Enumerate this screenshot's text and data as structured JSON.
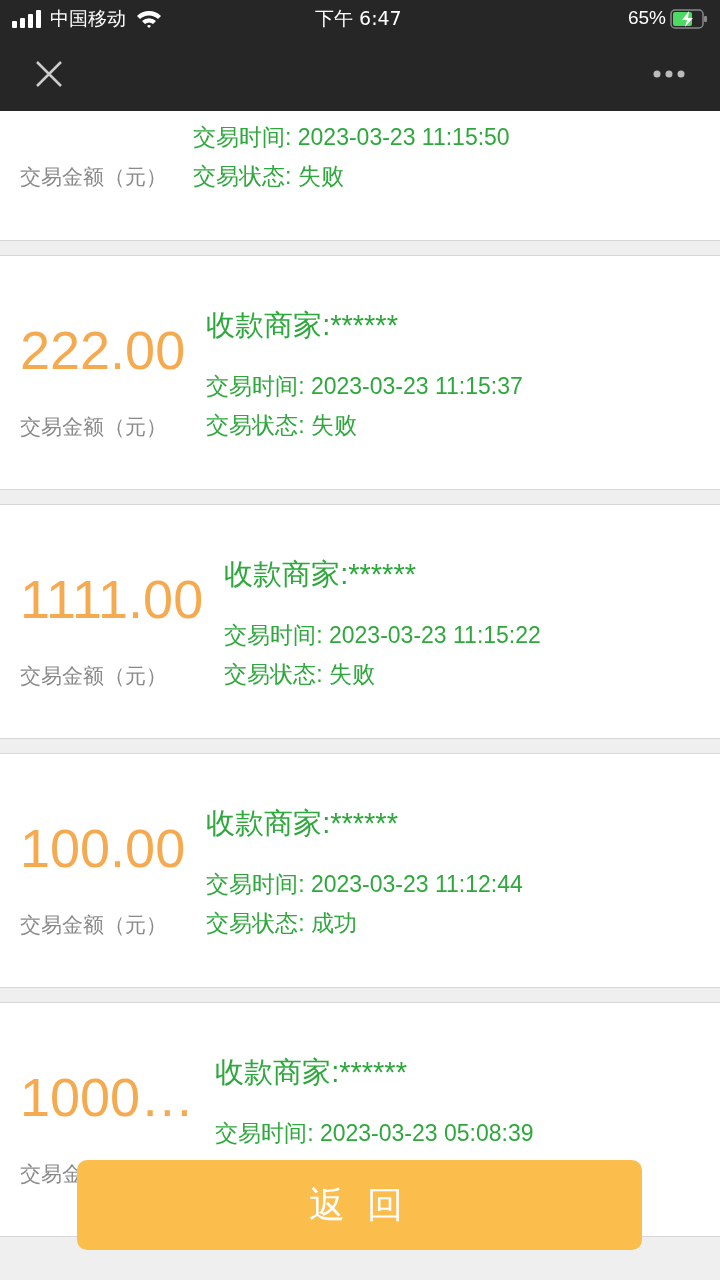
{
  "status_bar": {
    "carrier": "中国移动",
    "time": "下午 6:47",
    "battery": "65%"
  },
  "records": [
    {
      "time": "交易时间: 2023-03-23 11:15:50",
      "status": "交易状态: 失败",
      "amount_label": "交易金额（元）"
    },
    {
      "amount": "222.00",
      "merchant": "收款商家:******",
      "time": "交易时间: 2023-03-23 11:15:37",
      "status": "交易状态: 失败",
      "amount_label": "交易金额（元）"
    },
    {
      "amount": "1111.00",
      "merchant": "收款商家:******",
      "time": "交易时间: 2023-03-23 11:15:22",
      "status": "交易状态: 失败",
      "amount_label": "交易金额（元）"
    },
    {
      "amount": "100.00",
      "merchant": "收款商家:******",
      "time": "交易时间: 2023-03-23 11:12:44",
      "status": "交易状态: 成功",
      "amount_label": "交易金额（元）"
    },
    {
      "amount": "1000…",
      "merchant": "收款商家:******",
      "time": "交易时间: 2023-03-23 05:08:39",
      "amount_label": "交易金"
    }
  ],
  "back_button": "返 回"
}
